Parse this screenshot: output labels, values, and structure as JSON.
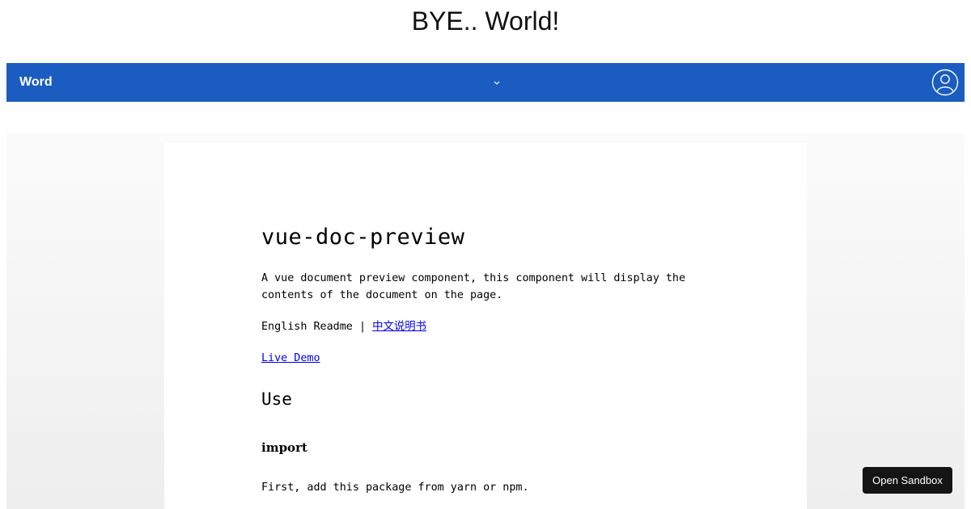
{
  "page": {
    "heading": "BYE.. World!"
  },
  "navbar": {
    "brand": "Word",
    "dropdown_icon": "chevron-down-icon",
    "user_icon": "user-circle-icon",
    "background": "#1a5cc0"
  },
  "document": {
    "title": "vue-doc-preview",
    "description": "A vue document preview component, this component will display the contents of the document on the page.",
    "readme_label": "English Readme",
    "separator": "|",
    "chinese_readme_link": "中文说明书",
    "live_demo_link": "Live Demo",
    "section_use": "Use",
    "subsection_import": "import",
    "import_text": "First, add this package from yarn or npm."
  },
  "sandbox": {
    "button_label": "Open Sandbox"
  }
}
